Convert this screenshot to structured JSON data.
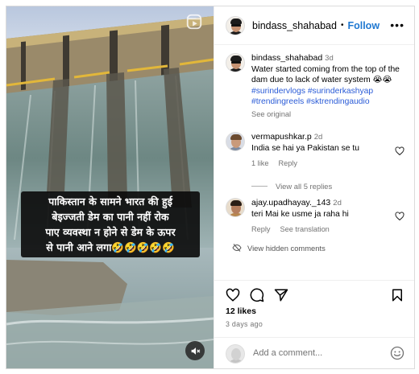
{
  "post": {
    "username": "bindass_shahabad",
    "follow_label": "Follow",
    "separator": "•",
    "overlay_lines": [
      "पाकिस्तान के सामने भारत की हुई",
      "बेइज्जती डेम का पानी नहीं रोक",
      "पाए व्यवस्था न होने से डेम के ऊपर",
      "से पानी आने लगा🤣🤣🤣🤣🤣"
    ]
  },
  "caption": {
    "username": "bindass_shahabad",
    "time": "3d",
    "text": "Water started coming from the top of the dam due to lack of water system 😭😭",
    "hashtags": "#surindervlogs #surinderkashyap #trendingreels #sktrendingaudio",
    "see_original": "See original"
  },
  "comments": [
    {
      "username": "vermapushkar.p",
      "time": "2d",
      "text": "India se hai ya Pakistan se tu",
      "likes": "1 like",
      "reply": "Reply",
      "view_replies": "View all 5 replies"
    },
    {
      "username": "ajay.upadhayay._143",
      "time": "2d",
      "text": "teri Mai ke usme ja raha hi",
      "reply": "Reply",
      "see_translation": "See translation"
    }
  ],
  "hidden_comments_label": "View hidden comments",
  "likes_count": "12 likes",
  "date": "3 days ago",
  "add_comment_placeholder": "Add a comment...",
  "icons": {
    "more": "more-options-icon",
    "like": "heart-icon",
    "comment": "comment-icon",
    "share": "share-icon",
    "save": "bookmark-icon",
    "mute": "muted-speaker-icon",
    "emoji": "emoji-icon",
    "hidden": "eye-slash-icon"
  },
  "colors": {
    "follow": "#1f78d1",
    "hashtag": "#2a5bd7",
    "secondary_text": "#737373",
    "border": "#dbdbdb"
  }
}
